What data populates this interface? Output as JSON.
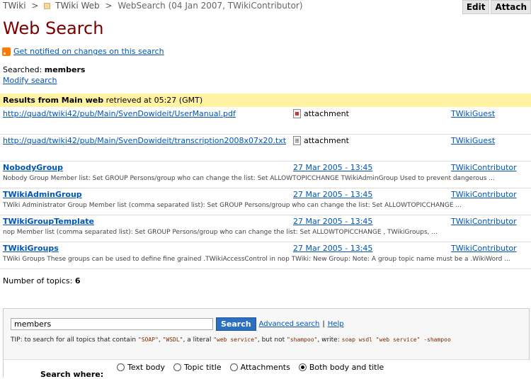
{
  "breadcrumb": {
    "root": "TWiki",
    "web": "TWiki Web",
    "current": "WebSearch (04 Jan 2007, TWikiContributor)"
  },
  "actions": {
    "edit": "Edit",
    "attach": "Attach"
  },
  "page_title": "Web Search",
  "notify_link": "Get notified on changes on this search",
  "searched": {
    "label": "Searched:",
    "value": "members"
  },
  "modify_link": "Modify search",
  "results_header": {
    "web": "Results from Main web",
    "retrieved": "retrieved at 05:27 (GMT)"
  },
  "results": [
    {
      "link": "http://quad/twiki42/pub/Main/SvenDowideit/UserManual.pdf",
      "type": "attachment",
      "icon": "pdf-file-icon",
      "user": "TWikiGuest",
      "summary": ""
    },
    {
      "link": "http://quad/twiki42/pub/Main/SvenDowideit/transcription2008x07x20.txt",
      "type": "attachment",
      "icon": "text-file-icon",
      "user": "TWikiGuest",
      "summary": ""
    },
    {
      "link": "NobodyGroup",
      "date": "27 Mar 2005 - 13:45",
      "user": "TWikiContributor",
      "summary": "Nobody Group Member list: Set GROUP Persons/group who can change the list: Set ALLOWTOPICCHANGE TWikiAdminGroup Used to prevent dangerous ..."
    },
    {
      "link": "TWikiAdminGroup",
      "date": "27 Mar 2005 - 13:45",
      "user": "TWikiContributor",
      "summary": "TWiki Administrator Group Member list (comma separated list): Set GROUP Persons/group who can change the list: Set ALLOWTOPICCHANGE ..."
    },
    {
      "link": "TWikiGroupTemplate",
      "date": "27 Mar 2005 - 13:45",
      "user": "TWikiContributor",
      "summary": "nop Member list (comma separated list): Set GROUP Persons/group who can change the list: Set ALLOWTOPICCHANGE , TWikiGroups, ..."
    },
    {
      "link": "TWikiGroups",
      "date": "27 Mar 2005 - 13:45",
      "user": "TWikiContributor",
      "summary": "TWiki Groups These groups can be used to define fine grained .TWikiAccessControl in nop TWiki: New Group: Note: A group topic name must be a .WikiWord ..."
    }
  ],
  "topic_count": {
    "label": "Number of topics:",
    "value": "6"
  },
  "search_form": {
    "query": "members",
    "button": "Search",
    "advanced": "Advanced search",
    "separator": "|",
    "help": "Help",
    "tip": {
      "prefix": "TIP: to search for all topics that contain",
      "q1": "\"SOAP\"",
      "sep1": ",",
      "q2": "\"WSDL\"",
      "mid": ", a literal",
      "q3": "\"web service\"",
      "mid2": ", but not",
      "q4": "\"shampoo\"",
      "mid3": ", write:",
      "q5": "soap wsdl \"web service\" -shampoo"
    },
    "where_label": "Search where:",
    "options": [
      {
        "label": "Text body",
        "selected": false
      },
      {
        "label": "Topic title",
        "selected": false
      },
      {
        "label": "Attachments",
        "selected": false
      },
      {
        "label": "Both body and title",
        "selected": true
      }
    ]
  }
}
